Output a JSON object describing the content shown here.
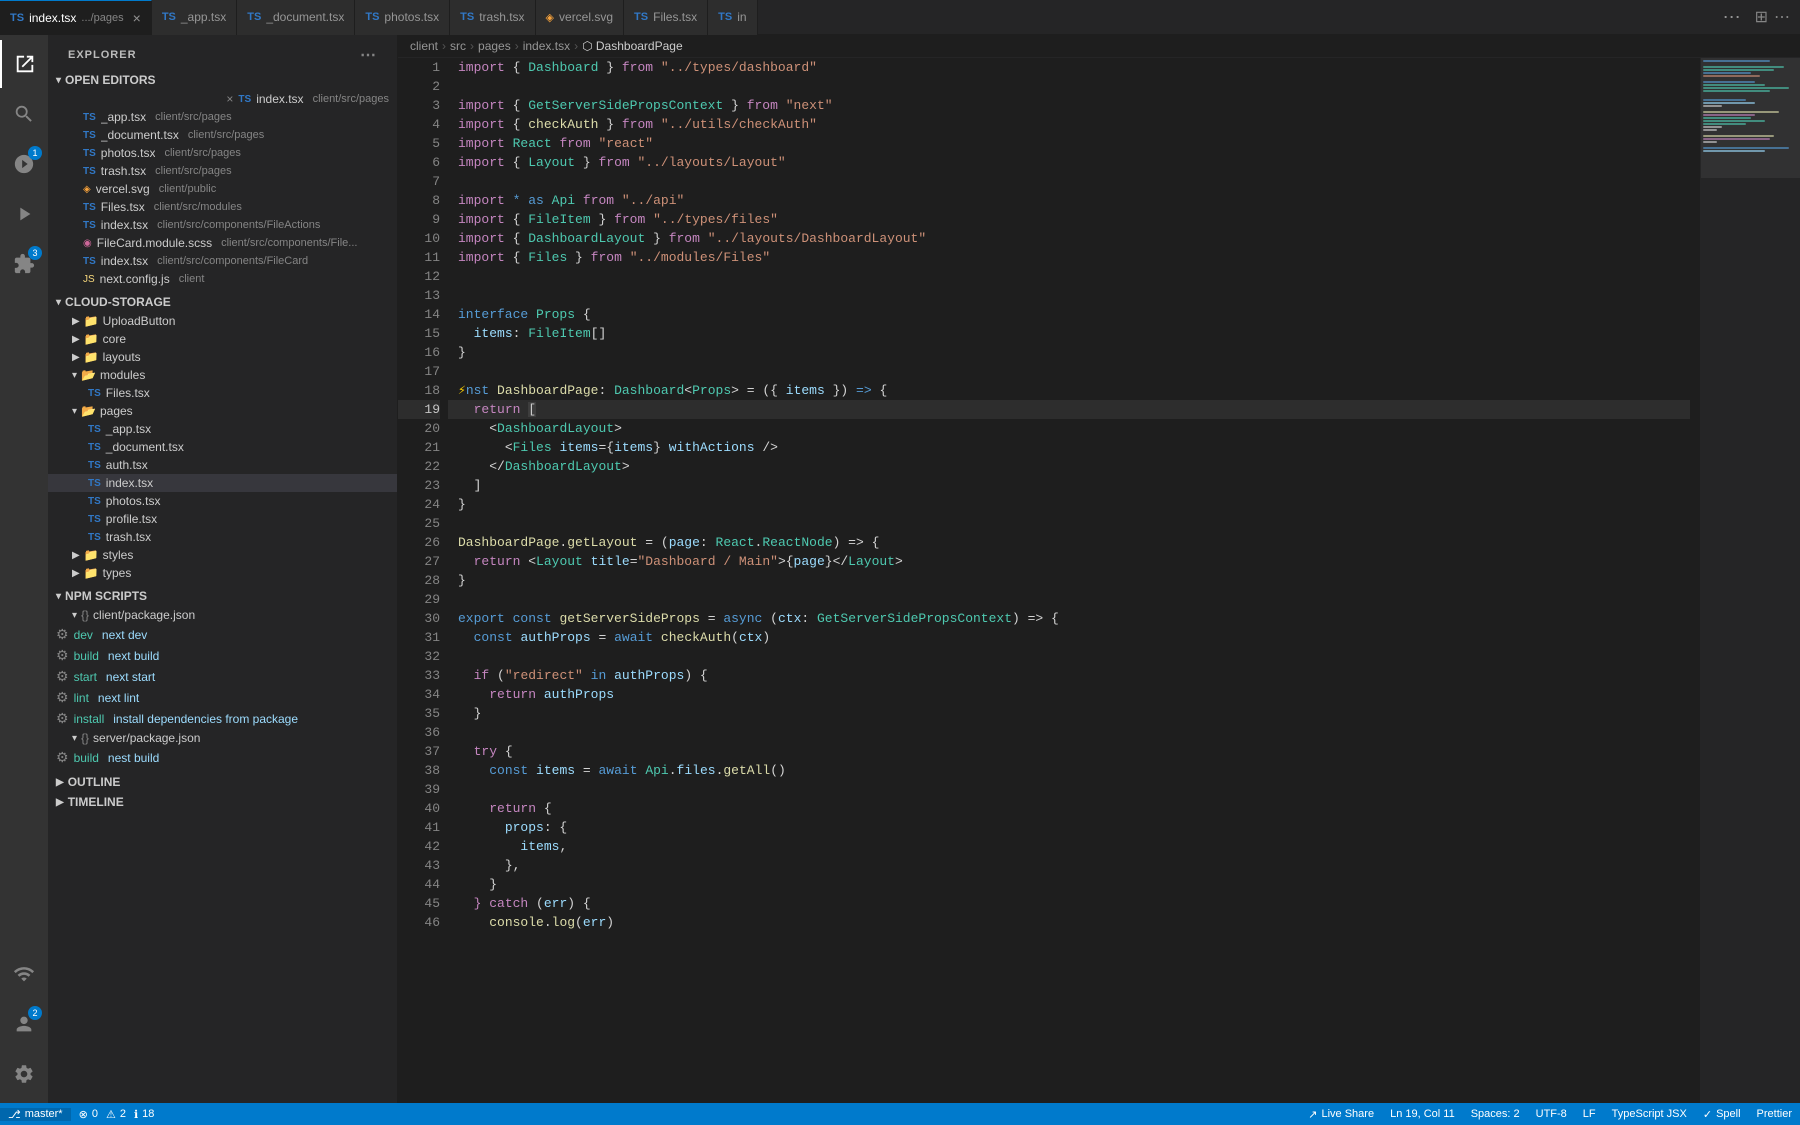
{
  "app": {
    "title": "EXPLORER"
  },
  "tabs": [
    {
      "id": "index-tsx",
      "label": "index.tsx",
      "path": ".../pages",
      "type": "ts",
      "active": true,
      "closeable": true
    },
    {
      "id": "app-tsx",
      "label": "_app.tsx",
      "type": "ts",
      "active": false
    },
    {
      "id": "document-tsx",
      "label": "_document.tsx",
      "type": "ts",
      "active": false
    },
    {
      "id": "photos-tsx",
      "label": "photos.tsx",
      "type": "ts",
      "active": false
    },
    {
      "id": "trash-tsx",
      "label": "trash.tsx",
      "type": "ts",
      "active": false
    },
    {
      "id": "vercel-svg",
      "label": "vercel.svg",
      "type": "svg",
      "active": false
    },
    {
      "id": "files-tsx",
      "label": "Files.tsx",
      "type": "ts",
      "active": false
    },
    {
      "id": "in",
      "label": "in",
      "type": "ts",
      "active": false
    }
  ],
  "breadcrumb": {
    "parts": [
      "client",
      "src",
      "pages",
      "index.tsx",
      "DashboardPage"
    ]
  },
  "sidebar": {
    "sections": {
      "open_editors": {
        "label": "OPEN EDITORS",
        "items": [
          {
            "icon": "ts",
            "name": "index.tsx",
            "path": "client/src/pages",
            "active": true,
            "closeable": true
          },
          {
            "icon": "ts",
            "name": "_app.tsx",
            "path": "client/src/pages"
          },
          {
            "icon": "ts",
            "name": "_document.tsx",
            "path": "client/src/pages"
          },
          {
            "icon": "ts",
            "name": "photos.tsx",
            "path": "client/src/pages"
          },
          {
            "icon": "ts",
            "name": "trash.tsx",
            "path": "client/src/pages"
          },
          {
            "icon": "svg",
            "name": "vercel.svg",
            "path": "client/public"
          },
          {
            "icon": "ts",
            "name": "Files.tsx",
            "path": "client/src/modules"
          },
          {
            "icon": "ts",
            "name": "index.tsx",
            "path": "client/src/components/FileActions"
          },
          {
            "icon": "scss",
            "name": "FileCard.module.scss",
            "path": "client/src/components/File..."
          },
          {
            "icon": "ts",
            "name": "index.tsx",
            "path": "client/src/components/FileCard"
          },
          {
            "icon": "js",
            "name": "next.config.js",
            "path": "client"
          }
        ]
      },
      "cloud_storage": {
        "label": "CLOUD-STORAGE",
        "folders": [
          {
            "name": "UploadButton",
            "open": false
          },
          {
            "name": "core",
            "open": false
          },
          {
            "name": "layouts",
            "open": false
          },
          {
            "name": "modules",
            "open": true,
            "items": [
              {
                "icon": "ts",
                "name": "Files.tsx"
              }
            ]
          },
          {
            "name": "pages",
            "open": true,
            "items": [
              {
                "icon": "ts",
                "name": "_app.tsx"
              },
              {
                "icon": "ts",
                "name": "_document.tsx"
              },
              {
                "icon": "ts",
                "name": "auth.tsx"
              },
              {
                "icon": "ts",
                "name": "index.tsx",
                "active": true
              }
            ]
          },
          {
            "icon": "ts",
            "name": "photos.tsx"
          },
          {
            "icon": "ts",
            "name": "profile.tsx"
          },
          {
            "icon": "ts",
            "name": "trash.tsx"
          },
          {
            "name": "styles",
            "open": false
          },
          {
            "name": "types",
            "open": false
          }
        ]
      },
      "npm_scripts": {
        "label": "NPM SCRIPTS",
        "groups": [
          {
            "name": "client/package.json",
            "open": true,
            "scripts": [
              {
                "name": "dev",
                "cmd": "next dev"
              },
              {
                "name": "build",
                "cmd": "next build"
              },
              {
                "name": "start",
                "cmd": "next start"
              },
              {
                "name": "lint",
                "cmd": "next lint"
              },
              {
                "name": "install",
                "cmd": "install dependencies from package"
              }
            ]
          },
          {
            "name": "server/package.json",
            "open": true,
            "scripts": [
              {
                "name": "build",
                "cmd": "nest build"
              }
            ]
          }
        ]
      },
      "outline": {
        "label": "OUTLINE"
      },
      "timeline": {
        "label": "TIMELINE"
      }
    }
  },
  "editor": {
    "filename": "index.tsx",
    "lines": [
      {
        "n": 1,
        "code": "import { Dashboard } from \"../types/dashboard\""
      },
      {
        "n": 2,
        "code": ""
      },
      {
        "n": 3,
        "code": "import { GetServerSidePropsContext } from \"next\""
      },
      {
        "n": 4,
        "code": "import { checkAuth } from \"../utils/checkAuth\""
      },
      {
        "n": 5,
        "code": "import React from \"react\""
      },
      {
        "n": 6,
        "code": "import { Layout } from \"../layouts/Layout\""
      },
      {
        "n": 7,
        "code": ""
      },
      {
        "n": 8,
        "code": "import * as Api from \"../api\""
      },
      {
        "n": 9,
        "code": "import { FileItem } from \"../types/files\""
      },
      {
        "n": 10,
        "code": "import { DashboardLayout } from \"../layouts/DashboardLayout\""
      },
      {
        "n": 11,
        "code": "import { Files } from \"../modules/Files\""
      },
      {
        "n": 12,
        "code": ""
      },
      {
        "n": 13,
        "code": ""
      },
      {
        "n": 14,
        "code": "interface Props {"
      },
      {
        "n": 15,
        "code": "  items: FileItem[]"
      },
      {
        "n": 16,
        "code": "}"
      },
      {
        "n": 17,
        "code": ""
      },
      {
        "n": 18,
        "code": "⚡nst DashboardPage: Dashboard<Props> = ({ items }) => {"
      },
      {
        "n": 19,
        "code": "  return ["
      },
      {
        "n": 20,
        "code": "    <DashboardLayout>"
      },
      {
        "n": 21,
        "code": "      <Files items={items} withActions />"
      },
      {
        "n": 22,
        "code": "    </DashboardLayout>"
      },
      {
        "n": 23,
        "code": "  ]"
      },
      {
        "n": 24,
        "code": "}"
      },
      {
        "n": 25,
        "code": ""
      },
      {
        "n": 26,
        "code": "DashboardPage.getLayout = (page: React.ReactNode) => {"
      },
      {
        "n": 27,
        "code": "  return <Layout title=\"Dashboard / Main\">{page}</Layout>"
      },
      {
        "n": 28,
        "code": "}"
      },
      {
        "n": 29,
        "code": ""
      },
      {
        "n": 30,
        "code": "export const getServerSideProps = async (ctx: GetServerSidePropsContext) => {"
      },
      {
        "n": 31,
        "code": "  const authProps = await checkAuth(ctx)"
      },
      {
        "n": 32,
        "code": ""
      },
      {
        "n": 33,
        "code": "  if (\"redirect\" in authProps) {"
      },
      {
        "n": 34,
        "code": "    return authProps"
      },
      {
        "n": 35,
        "code": "  }"
      },
      {
        "n": 36,
        "code": ""
      },
      {
        "n": 37,
        "code": "  try {"
      },
      {
        "n": 38,
        "code": "    const items = await Api.files.getAll()"
      },
      {
        "n": 39,
        "code": ""
      },
      {
        "n": 40,
        "code": "    return {"
      },
      {
        "n": 41,
        "code": "      props: {"
      },
      {
        "n": 42,
        "code": "        items,"
      },
      {
        "n": 43,
        "code": "      },"
      },
      {
        "n": 44,
        "code": "    }"
      },
      {
        "n": 45,
        "code": "  } catch (err) {"
      },
      {
        "n": 46,
        "code": "    console.log(err)"
      }
    ],
    "cursor": {
      "line": 19,
      "col": 11
    },
    "status": {
      "branch": "master*",
      "errors": 0,
      "warnings": 2,
      "infos": 18,
      "live_share": "Live Share",
      "position": "Ln 19, Col 11",
      "spaces": "Spaces: 2",
      "encoding": "UTF-8",
      "eol": "LF",
      "language": "TypeScript JSX",
      "spell": "Spell",
      "prettier": "Prettier"
    }
  }
}
